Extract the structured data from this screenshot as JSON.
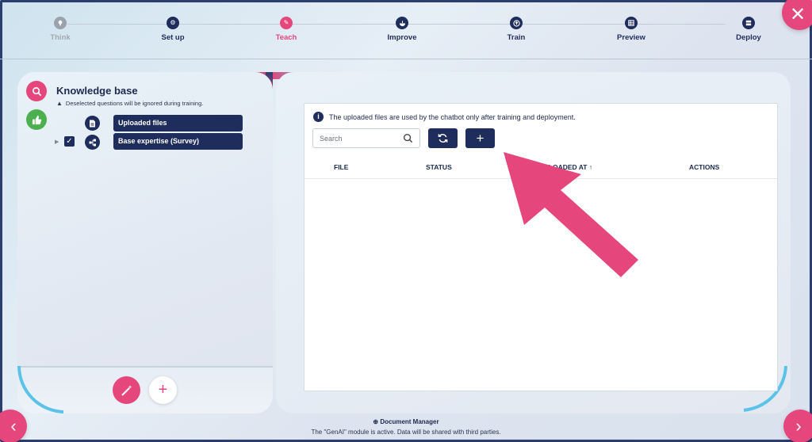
{
  "stepper": {
    "steps": [
      {
        "label": "Think",
        "icon": "lightbulb-icon",
        "state": "inactive"
      },
      {
        "label": "Set up",
        "icon": "gear-icon",
        "state": "done"
      },
      {
        "label": "Teach",
        "icon": "pencil-icon",
        "state": "active"
      },
      {
        "label": "Improve",
        "icon": "bowl-icon",
        "state": "done"
      },
      {
        "label": "Train",
        "icon": "upload-icon",
        "state": "done"
      },
      {
        "label": "Preview",
        "icon": "grid-icon",
        "state": "done"
      },
      {
        "label": "Deploy",
        "icon": "server-icon",
        "state": "done"
      }
    ]
  },
  "knowledge_base": {
    "title": "Knowledge base",
    "warning": "Deselected questions will be ignored during training.",
    "items": [
      {
        "label": "Uploaded files",
        "icon": "document-icon",
        "checkbox": false,
        "expandable": false
      },
      {
        "label": "Base expertise (Survey)",
        "icon": "hierarchy-icon",
        "checkbox": true,
        "checked": true,
        "expandable": true
      }
    ]
  },
  "document_manager": {
    "info": "The uploaded files are used by the chatbot only after training and deployment.",
    "search_placeholder": "Search",
    "columns": [
      "FILE",
      "STATUS",
      "UPLOADED AT",
      "ACTIONS"
    ],
    "sort_indicator": "↑"
  },
  "footer": {
    "title": "Document Manager",
    "note": "The \"GenAI\" module is active. Data will be shared with third parties."
  },
  "colors": {
    "accent": "#e5467b",
    "navy": "#1f2d5c",
    "success": "#4caf50",
    "arc": "#5bc3e8"
  }
}
